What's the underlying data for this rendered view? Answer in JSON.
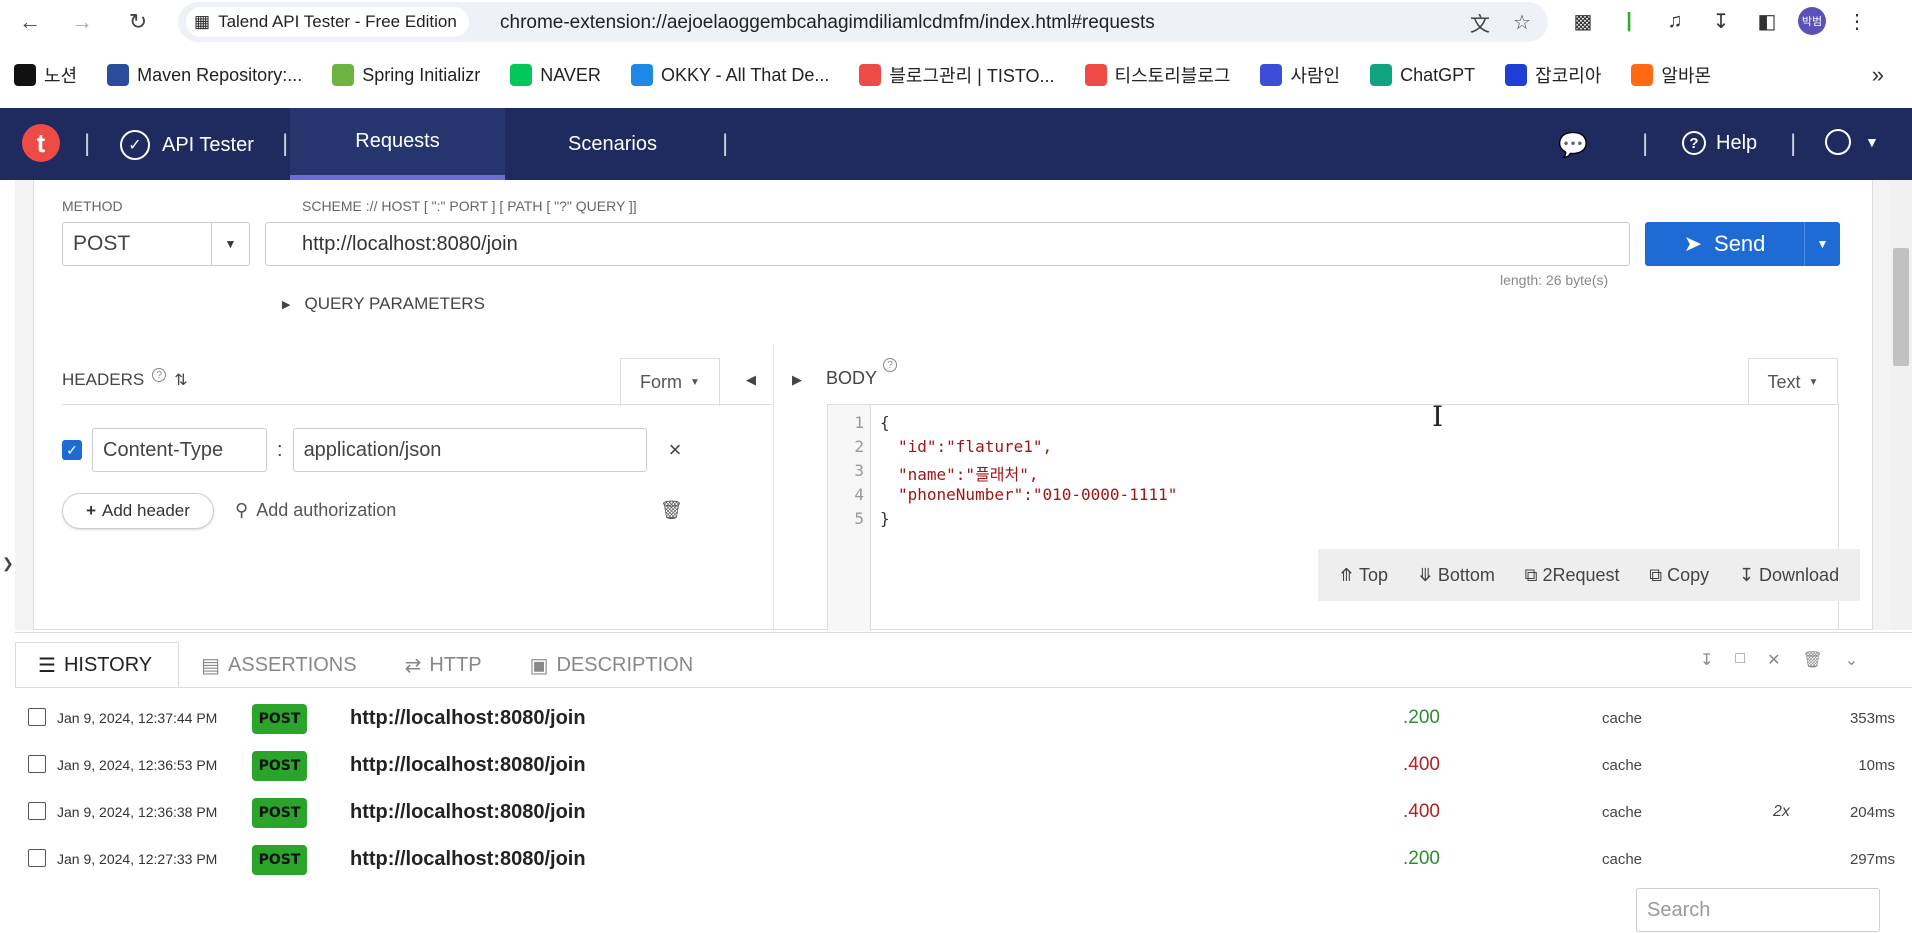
{
  "browser": {
    "tab_title": "Talend API Tester - Free Edition",
    "url": "chrome-extension://aejoelaoggembcahagimdiliamlcdmfm/index.html#requests",
    "profile_initials": "박범",
    "bookmarks": [
      {
        "label": "노션",
        "icon": "notion-icon",
        "color": "#111111"
      },
      {
        "label": "Maven Repository:...",
        "icon": "maven-icon",
        "color": "#2b4c9b"
      },
      {
        "label": "Spring Initializr",
        "icon": "spring-icon",
        "color": "#6db33f"
      },
      {
        "label": "NAVER",
        "icon": "naver-icon",
        "color": "#03c75a"
      },
      {
        "label": "OKKY - All That De...",
        "icon": "okky-icon",
        "color": "#1e88e5"
      },
      {
        "label": "블로그관리 | TISTO...",
        "icon": "tistory-icon",
        "color": "#ef4b46"
      },
      {
        "label": "티스토리블로그",
        "icon": "tistory-icon",
        "color": "#ef4b46"
      },
      {
        "label": "사람인",
        "icon": "saramin-icon",
        "color": "#3d4dd6"
      },
      {
        "label": "ChatGPT",
        "icon": "chatgpt-icon",
        "color": "#10a37f"
      },
      {
        "label": "잡코리아",
        "icon": "jobkorea-icon",
        "color": "#1d3fd6"
      },
      {
        "label": "알바몬",
        "icon": "albamon-icon",
        "color": "#ff6a13"
      }
    ]
  },
  "appnav": {
    "logo": "t",
    "product": "API Tester",
    "tabs": [
      "Requests",
      "Scenarios"
    ],
    "help": "Help"
  },
  "request": {
    "method_label": "METHOD",
    "scheme_hint": "SCHEME :// HOST [ \":\" PORT ] [ PATH [ \"?\" QUERY ]]",
    "method": "POST",
    "url": "http://localhost:8080/join",
    "send": "Send",
    "length": "length: 26 byte(s)",
    "query_parameters": "QUERY PARAMETERS"
  },
  "headers": {
    "title": "HEADERS",
    "mode": "Form",
    "rows": [
      {
        "name": "Content-Type",
        "value": "application/json",
        "enabled": true
      }
    ],
    "add_header": "Add header",
    "add_authorization": "Add authorization"
  },
  "body": {
    "title": "BODY",
    "mode": "Text",
    "line_numbers": [
      "1",
      "2",
      "3",
      "4",
      "5"
    ],
    "lines": [
      "{",
      "\"id\":\"flature1\",",
      "\"name\":\"플래처\",",
      "\"phoneNumber\":\"010-0000-1111\"",
      "}"
    ],
    "toolbar": [
      "Top",
      "Bottom",
      "2Request",
      "Copy",
      "Download"
    ]
  },
  "bottom_tabs": [
    "HISTORY",
    "ASSERTIONS",
    "HTTP",
    "DESCRIPTION"
  ],
  "history": [
    {
      "date": "Jan 9, 2024, 12:37:44 PM",
      "method": "POST",
      "url": "http://localhost:8080/join",
      "status": ".200",
      "status_color": "#2e8b2e",
      "cache": "cache",
      "multiplier": "",
      "time": "353ms"
    },
    {
      "date": "Jan 9, 2024, 12:36:53 PM",
      "method": "POST",
      "url": "http://localhost:8080/join",
      "status": ".400",
      "status_color": "#b22222",
      "cache": "cache",
      "multiplier": "",
      "time": "10ms"
    },
    {
      "date": "Jan 9, 2024, 12:36:38 PM",
      "method": "POST",
      "url": "http://localhost:8080/join",
      "status": ".400",
      "status_color": "#b22222",
      "cache": "cache",
      "multiplier": "2x",
      "time": "204ms"
    },
    {
      "date": "Jan 9, 2024, 12:27:33 PM",
      "method": "POST",
      "url": "http://localhost:8080/join",
      "status": ".200",
      "status_color": "#2e8b2e",
      "cache": "cache",
      "multiplier": "",
      "time": "297ms"
    }
  ],
  "search_placeholder": "Search"
}
